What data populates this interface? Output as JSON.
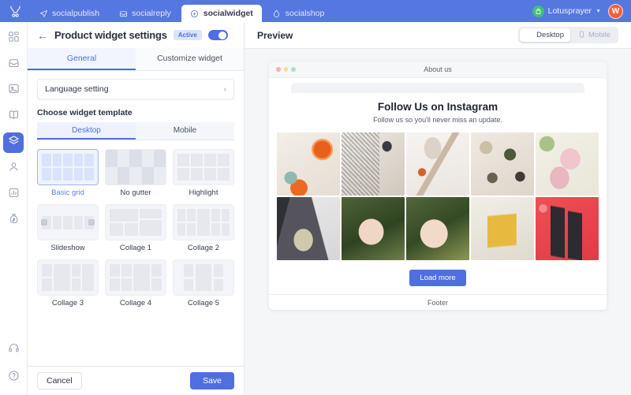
{
  "topbar": {
    "logo_icon": "antler-logo-icon",
    "tabs": [
      {
        "label": "socialpublish",
        "icon": "paper-plane-icon",
        "active": false
      },
      {
        "label": "socialreply",
        "icon": "inbox-reply-icon",
        "active": false
      },
      {
        "label": "socialwidget",
        "icon": "target-circle-icon",
        "active": true
      },
      {
        "label": "socialshop",
        "icon": "tag-icon",
        "active": false
      }
    ],
    "account": {
      "name": "Lotusprayer",
      "badge_icon": "shop-bag-icon",
      "caret_icon": "chevron-down-icon",
      "avatar_initial": "W"
    }
  },
  "rail": {
    "items": [
      {
        "icon": "dashboard-grid-icon",
        "active": false
      },
      {
        "icon": "inbox-icon",
        "active": false
      },
      {
        "icon": "image-icon",
        "active": false
      },
      {
        "icon": "book-icon",
        "active": false
      },
      {
        "icon": "layers-icon",
        "active": true
      },
      {
        "icon": "user-icon",
        "active": false
      },
      {
        "icon": "bar-chart-icon",
        "active": false
      },
      {
        "icon": "money-bag-icon",
        "active": false
      }
    ],
    "bottom_items": [
      {
        "icon": "headset-support-icon",
        "active": false
      },
      {
        "icon": "help-circle-icon",
        "active": false
      }
    ]
  },
  "panel": {
    "back_icon": "arrow-left-icon",
    "title": "Product widget settings",
    "status_badge": "Active",
    "toggle_on": true,
    "tabs": [
      {
        "label": "General",
        "active": true
      },
      {
        "label": "Customize widget",
        "active": false
      }
    ],
    "language_setting": {
      "label": "Language setting",
      "chevron_icon": "chevron-right-icon"
    },
    "template_section_label": "Choose widget template",
    "device_segments": [
      {
        "label": "Desktop",
        "active": true
      },
      {
        "label": "Mobile",
        "active": false
      }
    ],
    "templates": [
      {
        "label": "Basic grid",
        "selected": true,
        "kind": "grid5x2"
      },
      {
        "label": "No gutter",
        "selected": false,
        "kind": "nogutter"
      },
      {
        "label": "Highlight",
        "selected": false,
        "kind": "highlight"
      },
      {
        "label": "Slideshow",
        "selected": false,
        "kind": "slideshow"
      },
      {
        "label": "Collage 1",
        "selected": false,
        "kind": "collage1"
      },
      {
        "label": "Collage 2",
        "selected": false,
        "kind": "collage2"
      },
      {
        "label": "Collage 3",
        "selected": false,
        "kind": "collage3"
      },
      {
        "label": "Collage 4",
        "selected": false,
        "kind": "collage4"
      },
      {
        "label": "Collage 5",
        "selected": false,
        "kind": "collage5"
      }
    ],
    "footer": {
      "cancel_label": "Cancel",
      "save_label": "Save"
    }
  },
  "preview": {
    "title": "Preview",
    "device_buttons": [
      {
        "label": "Desktop",
        "icon": "monitor-icon",
        "active": true
      },
      {
        "label": "Mobile",
        "icon": "phone-icon",
        "active": false
      }
    ],
    "browser": {
      "tab_title": "About us",
      "dots": [
        "red",
        "yellow",
        "green"
      ]
    },
    "widget": {
      "heading": "Follow Us on Instagram",
      "subheading": "Follow us so you'll never miss an update.",
      "load_more_label": "Load more",
      "footer_label": "Footer",
      "photos": [
        {
          "alt": "orange-citrus-skincare-tubes"
        },
        {
          "alt": "striped-packaging-dropper-bottle"
        },
        {
          "alt": "gua-sha-tools-serum"
        },
        {
          "alt": "flatlay-herbs-stones-bottles"
        },
        {
          "alt": "pink-tubes-cucumber-slices"
        },
        {
          "alt": "dark-bottles-grey-flatlay"
        },
        {
          "alt": "hand-holding-dropper-greenery"
        },
        {
          "alt": "hand-holding-white-bottle-plants"
        },
        {
          "alt": "yellow-oil-bottle-closeup"
        },
        {
          "alt": "two-dropper-bottles-red-bubblewrap"
        }
      ]
    }
  },
  "colors": {
    "brand_blue": "#4f6fe0",
    "topbar_blue": "#5577e0",
    "accent_green": "#3fc07a",
    "avatar_orange": "#f0603d",
    "panel_bg": "#ffffff",
    "canvas_bg": "#f5f6f8"
  }
}
